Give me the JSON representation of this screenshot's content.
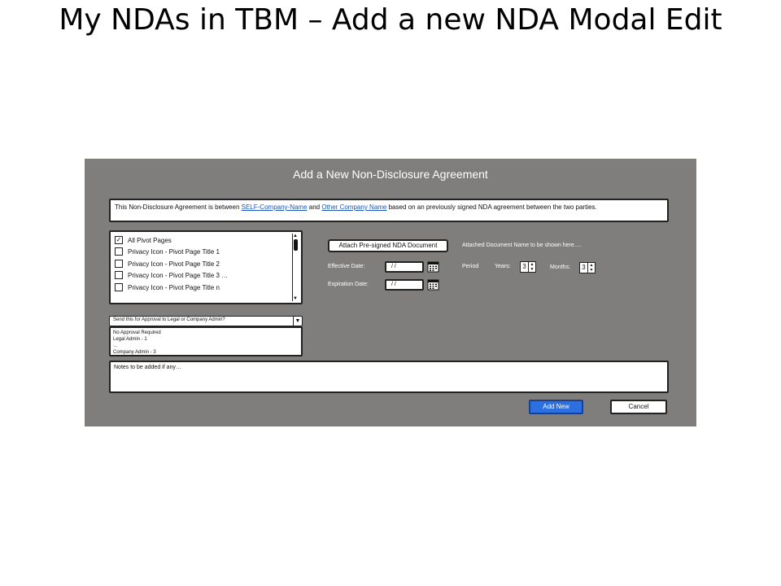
{
  "slide": {
    "title": "My NDAs in TBM – Add a new NDA Modal Edit"
  },
  "modal": {
    "title": "Add a New Non-Disclosure Agreement",
    "intro": {
      "prefix": "This Non-Disclosure Agreement is between ",
      "link1": "SELF-Company-Name",
      "middle": " and ",
      "link2": "Other Company Name",
      "suffix": " based on an previously signed NDA agreement between the two parties."
    },
    "pivot_pages": [
      {
        "label": "All Pivot Pages",
        "checked": true
      },
      {
        "label": "Privacy Icon - Pivot Page Title 1",
        "checked": false
      },
      {
        "label": "Privacy Icon - Pivot Page Title 2",
        "checked": false
      },
      {
        "label": "Privacy Icon - Pivot Page Title 3 …",
        "checked": false
      },
      {
        "label": "Privacy Icon - Pivot Page Title n",
        "checked": false
      }
    ],
    "approval": {
      "selected": "Send this for Approval to Legal or Company Admin?",
      "options": [
        "No Approval Required",
        "Legal Admin - 1",
        "…",
        "Company Admin - 3"
      ]
    },
    "attach_button": "Attach Pre-signed NDA Document",
    "attached_name": "Attached Document Name to be shown here….",
    "effective_date": {
      "label": "Effective Date:",
      "value": "/ /"
    },
    "expiration_date": {
      "label": "Expiration Date:",
      "value": "/ /"
    },
    "period": {
      "label": "Period",
      "years_label": "Years:",
      "years_value": "3",
      "months_label": "Months:",
      "months_value": "3"
    },
    "notes_placeholder": "Notes to be added if any…",
    "add_button": "Add New",
    "cancel_button": "Cancel"
  },
  "icons": [
    "check-icon",
    "calendar-icon",
    "chevron-down-icon",
    "spinner-up-icon",
    "spinner-down-icon"
  ],
  "colors": {
    "modal_bg": "#807e7c",
    "primary_button": "#2b6fe0",
    "link": "#1a55b8"
  }
}
